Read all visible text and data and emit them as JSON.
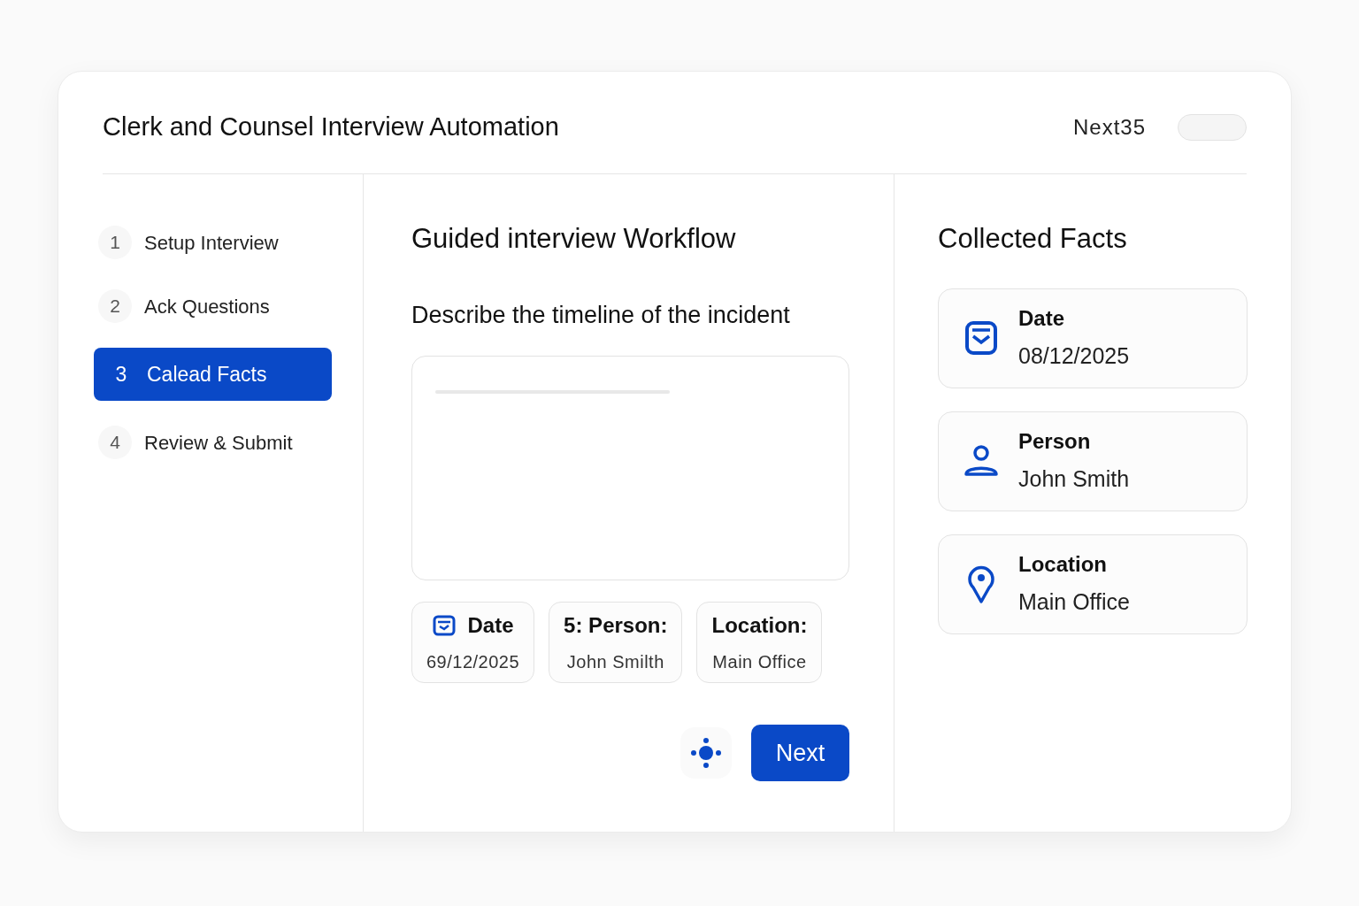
{
  "header": {
    "title": "Clerk and Counsel Interview Automation",
    "badge": "Next35",
    "toggle": {
      "on": false
    }
  },
  "steps": [
    {
      "number": "1",
      "label": "Setup Interview",
      "selected": false
    },
    {
      "number": "2",
      "label": "Ack Questions",
      "selected": false
    },
    {
      "number": "3",
      "label": "Calead Facts",
      "selected": true
    },
    {
      "number": "4",
      "label": "Review & Submit",
      "selected": false
    }
  ],
  "workflow": {
    "title": "Guided interview Workflow",
    "question": "Describe the timeline of the incident",
    "chips": [
      {
        "kind": "date",
        "label": "Date",
        "value": "69/12/2025"
      },
      {
        "kind": "plain",
        "label": "5: Person:",
        "value": "John Smilth"
      },
      {
        "kind": "plain",
        "label": "Location:",
        "value": "Main Office"
      }
    ],
    "next_button": "Next"
  },
  "facts": {
    "title": "Collected Facts",
    "items": [
      {
        "kind": "date",
        "label": "Date",
        "value": "08/12/2025"
      },
      {
        "kind": "person",
        "label": "Person",
        "value": "John Smith"
      },
      {
        "kind": "location",
        "label": "Location",
        "value": "Main Office"
      }
    ]
  }
}
